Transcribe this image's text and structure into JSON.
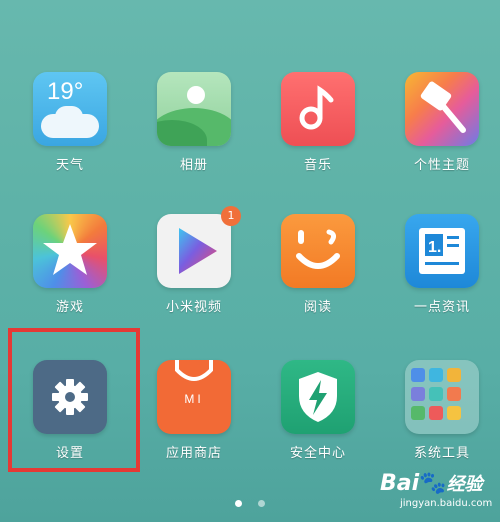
{
  "apps": [
    {
      "label": "天气",
      "temp": "19°"
    },
    {
      "label": "相册"
    },
    {
      "label": "音乐"
    },
    {
      "label": "个性主题"
    },
    {
      "label": "游戏"
    },
    {
      "label": "小米视频",
      "badge": "1"
    },
    {
      "label": "阅读"
    },
    {
      "label": "一点资讯"
    },
    {
      "label": "设置"
    },
    {
      "label": "应用商店",
      "logo": "MI"
    },
    {
      "label": "安全中心"
    },
    {
      "label": "系统工具"
    }
  ],
  "watermark": {
    "brand": "Bai",
    "brand2": "经验",
    "url": "jingyan.baidu.com"
  },
  "pager": {
    "pages": 2,
    "active": 0
  }
}
